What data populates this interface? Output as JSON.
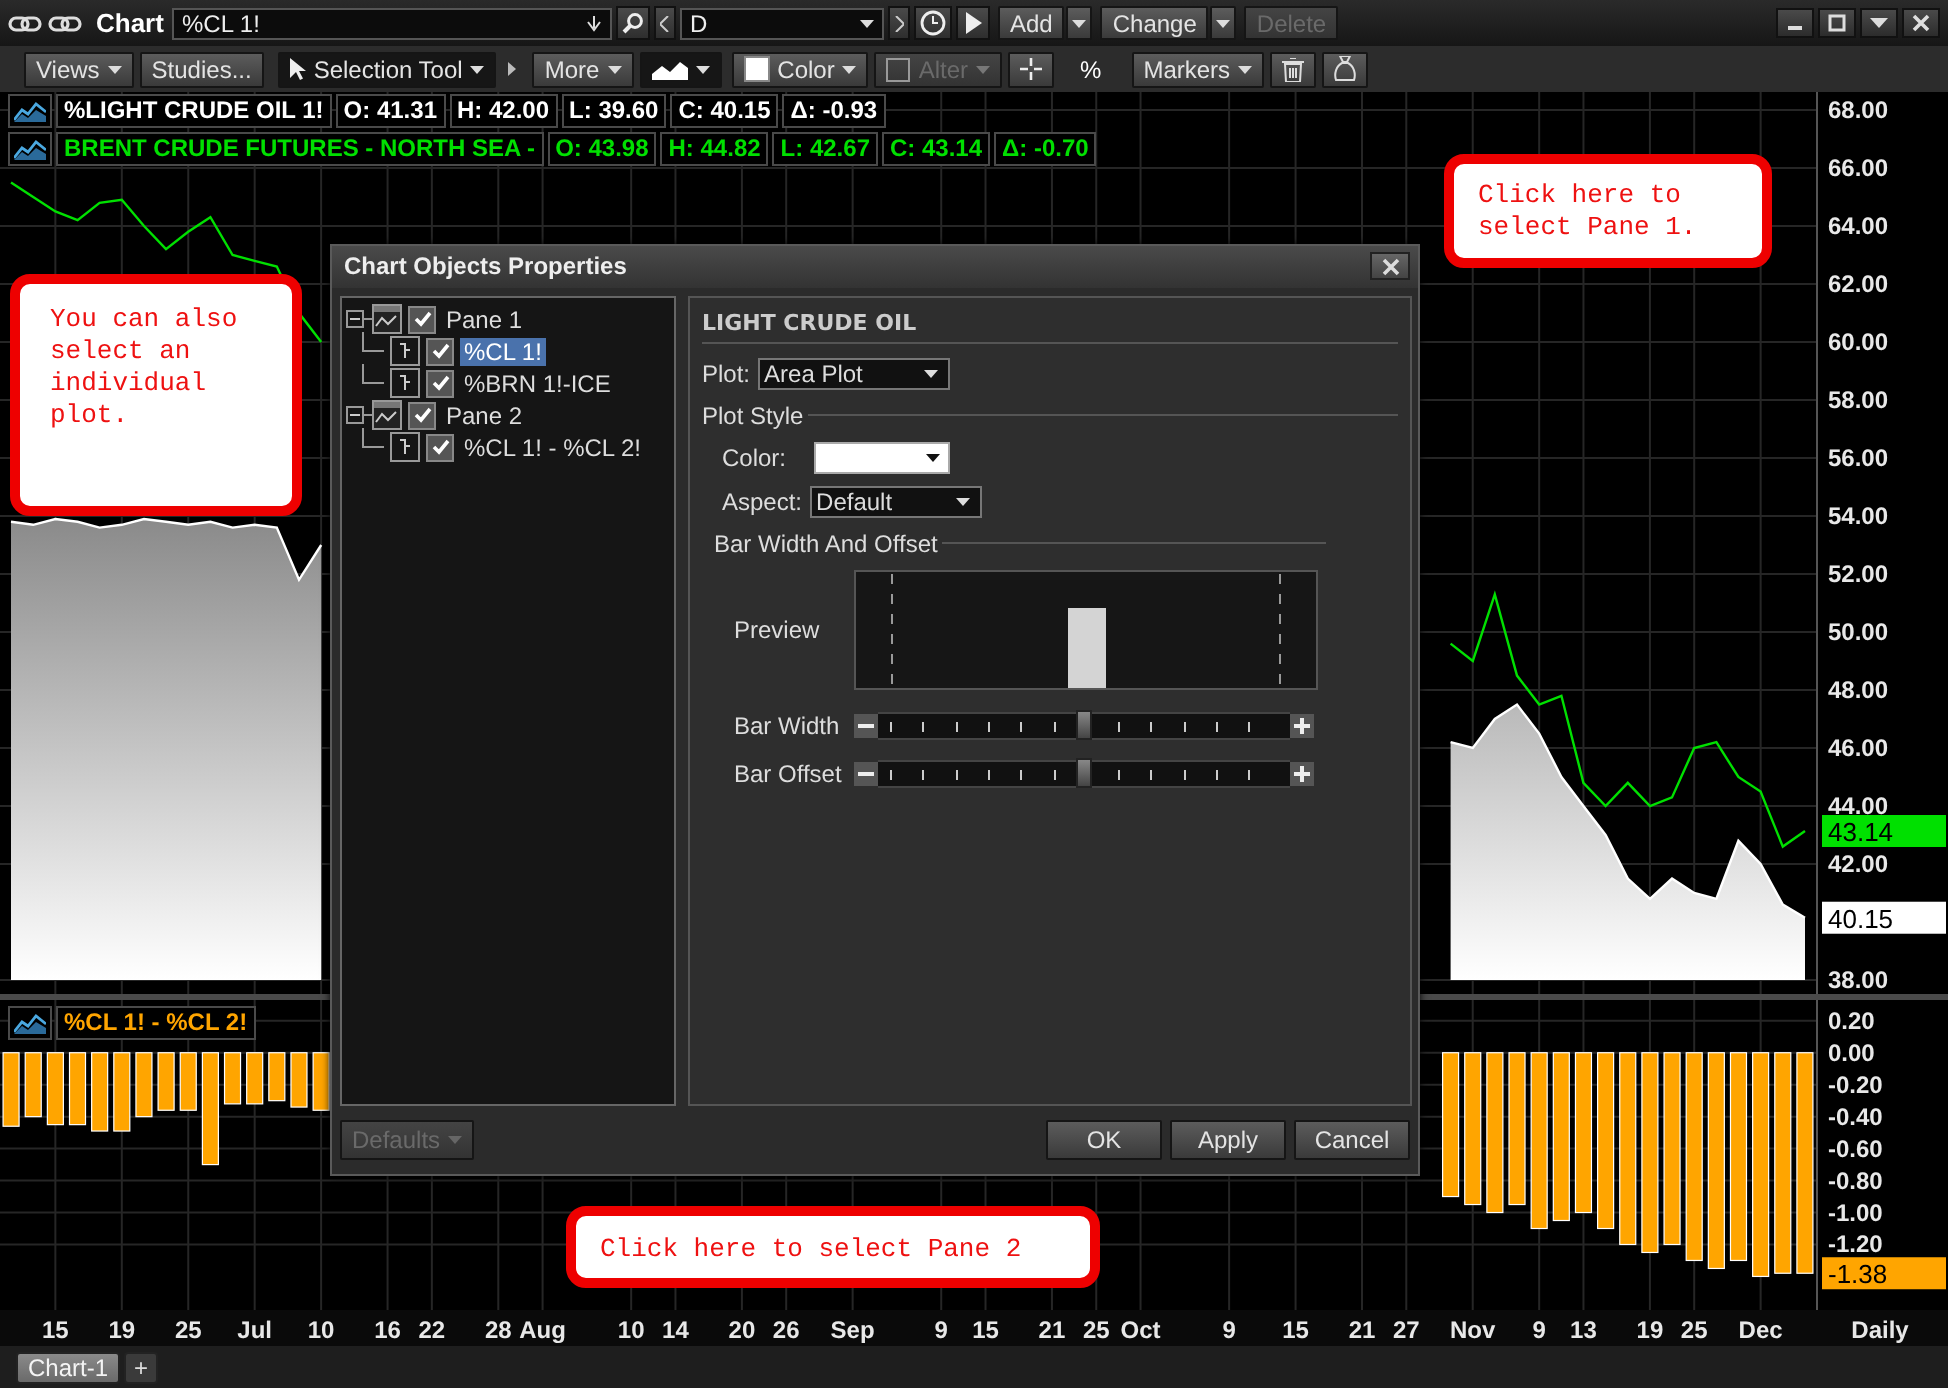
{
  "window": {
    "title": "Chart",
    "symbol": "%CL 1!",
    "period": "D",
    "buttons": [
      {
        "label": "Add",
        "disabled": false
      },
      {
        "label": "Change",
        "disabled": false
      },
      {
        "label": "Delete",
        "disabled": true
      }
    ]
  },
  "toolbar": [
    {
      "kind": "menu",
      "label": "Views",
      "disabled": false
    },
    {
      "kind": "button",
      "label": "Studies...",
      "disabled": false
    },
    {
      "kind": "tool",
      "label": "Selection Tool",
      "disabled": false
    },
    {
      "kind": "chevron",
      "disabled": false
    },
    {
      "kind": "menu",
      "label": "More",
      "disabled": false
    },
    {
      "kind": "charttype",
      "disabled": false
    },
    {
      "kind": "color",
      "label": "Color",
      "disabled": false
    },
    {
      "kind": "check",
      "label": "Alter",
      "disabled": true
    },
    {
      "kind": "crosshair",
      "disabled": false
    },
    {
      "kind": "text",
      "label": "%",
      "disabled": false
    },
    {
      "kind": "menu",
      "label": "Markers",
      "disabled": false
    },
    {
      "kind": "trash",
      "disabled": false
    },
    {
      "kind": "bag",
      "disabled": false
    }
  ],
  "legends": [
    {
      "fields": [
        "O: 41.31",
        "H: 42.00",
        "L: 39.60",
        "C: 40.15",
        "Δ: -0.93"
      ]
    },
    {
      "fields": [
        "O: 43.98",
        "H: 44.82",
        "L: 42.67",
        "C: 43.14",
        "Δ: -0.70"
      ]
    }
  ],
  "price_chart": {
    "chart_data": {
      "type": "line",
      "ylim": [
        37.52,
        68.62
      ],
      "grid": true,
      "yticks": [
        {
          "value": 68,
          "label": "68.00"
        },
        {
          "value": 66,
          "label": "66.00"
        },
        {
          "value": 64,
          "label": "64.00"
        },
        {
          "value": 62,
          "label": "62.00"
        },
        {
          "value": 60,
          "label": "60.00"
        },
        {
          "value": 58,
          "label": "58.00"
        },
        {
          "value": 56,
          "label": "56.00"
        },
        {
          "value": 54,
          "label": "54.00"
        },
        {
          "value": 52,
          "label": "52.00"
        },
        {
          "value": 50,
          "label": "50.00"
        },
        {
          "value": 48,
          "label": "48.00"
        },
        {
          "value": 46,
          "label": "46.00"
        },
        {
          "value": 44,
          "label": "44.00"
        },
        {
          "value": 42,
          "label": "42.00"
        },
        {
          "value": 38,
          "label": "38.00"
        }
      ],
      "series": [
        {
          "name": "%LIGHT CRUDE OIL 1!",
          "color": "#ffffff",
          "values": [
            53.8,
            53.7,
            53.9,
            53.8,
            53.6,
            53.7,
            53.9,
            53.8,
            53.7,
            53.8,
            53.6,
            53.7,
            53.6,
            51.8,
            53.0,
            null,
            null,
            null,
            null,
            null,
            null,
            null,
            null,
            null,
            null,
            null,
            null,
            null,
            null,
            null,
            null,
            null,
            null,
            null,
            null,
            null,
            null,
            null,
            null,
            null,
            null,
            null,
            null,
            null,
            null,
            null,
            null,
            null,
            null,
            null,
            null,
            null,
            null,
            null,
            null,
            null,
            null,
            null,
            null,
            null,
            null,
            null,
            null,
            null,
            null,
            46.2,
            46.0,
            47.0,
            47.5,
            46.5,
            45.0,
            44.0,
            43.0,
            41.5,
            40.8,
            41.5,
            41.0,
            40.8,
            42.8,
            42.0,
            40.6,
            40.15
          ]
        },
        {
          "name": "BRENT CRUDE FUTURES - NORTH SEA -",
          "color": "#00e000",
          "values": [
            65.5,
            65.0,
            64.5,
            64.2,
            64.8,
            64.9,
            64.0,
            63.2,
            63.8,
            64.3,
            63.0,
            62.8,
            62.6,
            61.0,
            60.0,
            null,
            null,
            null,
            null,
            null,
            null,
            null,
            null,
            null,
            null,
            null,
            null,
            null,
            null,
            null,
            null,
            null,
            null,
            null,
            null,
            null,
            null,
            null,
            null,
            null,
            null,
            null,
            null,
            null,
            null,
            null,
            null,
            null,
            null,
            null,
            null,
            null,
            null,
            null,
            null,
            null,
            null,
            null,
            null,
            null,
            null,
            null,
            null,
            null,
            null,
            49.6,
            49.0,
            51.3,
            48.5,
            47.5,
            47.8,
            44.8,
            44.0,
            44.8,
            44.0,
            44.3,
            46.0,
            46.2,
            45.0,
            44.5,
            42.6,
            43.14
          ]
        }
      ]
    },
    "fills": [
      true,
      false
    ],
    "tags": [
      {
        "text": "43.14"
      },
      {
        "text": "40.15"
      }
    ]
  },
  "spread_chart": {
    "chart_data": {
      "type": "bar",
      "xlabel": "Daily",
      "ylim": [
        -1.61,
        0.33
      ],
      "grid": true,
      "yticks": [
        {
          "value": 0.2,
          "label": "0.20"
        },
        {
          "value": 0,
          "label": "0.00"
        },
        {
          "value": -0.2,
          "label": "-0.20"
        },
        {
          "value": -0.4,
          "label": "-0.40"
        },
        {
          "value": -0.6,
          "label": "-0.60"
        },
        {
          "value": -0.8,
          "label": "-0.80"
        },
        {
          "value": -1.0,
          "label": "-1.00"
        },
        {
          "value": -1.2,
          "label": "-1.20"
        }
      ],
      "categories": [
        null,
        null,
        "15",
        null,
        null,
        "19",
        null,
        null,
        "25",
        null,
        null,
        "Jul",
        null,
        null,
        "10",
        null,
        null,
        "16",
        null,
        "22",
        null,
        null,
        "28",
        null,
        "Aug",
        null,
        null,
        null,
        "10",
        null,
        "14",
        null,
        null,
        "20",
        null,
        "26",
        null,
        null,
        "Sep",
        null,
        null,
        null,
        "9",
        null,
        "15",
        null,
        null,
        "21",
        null,
        "25",
        null,
        "Oct",
        null,
        null,
        null,
        "9",
        null,
        null,
        "15",
        null,
        null,
        "21",
        null,
        "27",
        null,
        null,
        "Nov",
        null,
        null,
        "9",
        null,
        "13",
        null,
        null,
        "19",
        null,
        "25",
        null,
        null,
        "Dec",
        null,
        null
      ],
      "series": [
        {
          "name": "%CL 1! - %CL 2!",
          "color": "#ffa500",
          "values": [
            -0.46,
            -0.4,
            -0.45,
            -0.45,
            -0.49,
            -0.49,
            -0.4,
            -0.36,
            -0.36,
            -0.7,
            -0.32,
            -0.32,
            -0.3,
            -0.34,
            -0.36,
            null,
            null,
            null,
            null,
            null,
            null,
            null,
            null,
            null,
            null,
            null,
            null,
            null,
            null,
            null,
            null,
            null,
            null,
            null,
            null,
            null,
            null,
            null,
            null,
            null,
            null,
            null,
            null,
            null,
            null,
            null,
            null,
            null,
            null,
            null,
            null,
            null,
            null,
            null,
            null,
            null,
            null,
            null,
            null,
            null,
            null,
            null,
            null,
            null,
            null,
            -0.9,
            -0.95,
            -1.0,
            -0.95,
            -1.1,
            -1.05,
            -1.0,
            -1.1,
            -1.2,
            -1.25,
            -1.2,
            -1.3,
            -1.35,
            -1.3,
            -1.4,
            -1.38,
            -1.38
          ]
        }
      ]
    },
    "tag": "-1.38"
  },
  "callouts": [
    {
      "text": "You can also select an individual plot."
    },
    {
      "text": "Click here to select Pane 1."
    },
    {
      "text": "Click here to select Pane 2"
    }
  ],
  "dialog": {
    "title": "Chart Objects Properties",
    "tree": [
      {
        "label": "Pane 1",
        "expanded": true,
        "checked": true,
        "selected": false,
        "children": [
          {
            "label": "%CL 1!",
            "checked": true,
            "selected": true
          },
          {
            "label": "%BRN 1!-ICE",
            "checked": true,
            "selected": false
          }
        ]
      },
      {
        "label": "Pane 2",
        "expanded": true,
        "checked": true,
        "selected": false,
        "children": [
          {
            "label": "%CL 1! - %CL 2!",
            "checked": true,
            "selected": false
          }
        ]
      }
    ],
    "heading": "LIGHT CRUDE OIL",
    "plot": {
      "label": "Plot:",
      "value": "Area Plot"
    },
    "plot_style": "Plot Style",
    "color": {
      "label": "Color:",
      "color": "#ffffff"
    },
    "aspect": {
      "label": "Aspect:",
      "value": "Default"
    },
    "bar_group": "Bar Width And Offset",
    "preview_label": "Preview",
    "sliders": [
      {
        "label": "Bar Width",
        "level": 0.5
      },
      {
        "label": "Bar Offset",
        "level": 0.5
      }
    ],
    "buttons": [
      {
        "kind": "menu",
        "label": "Defaults",
        "disabled": true
      },
      {
        "kind": "button",
        "label": "OK",
        "disabled": false
      },
      {
        "kind": "button",
        "label": "Apply",
        "disabled": false
      },
      {
        "kind": "button",
        "label": "Cancel",
        "disabled": false
      }
    ]
  },
  "tabs": [
    {
      "label": "Chart-1",
      "selected": true
    }
  ],
  "new_tab": "+"
}
